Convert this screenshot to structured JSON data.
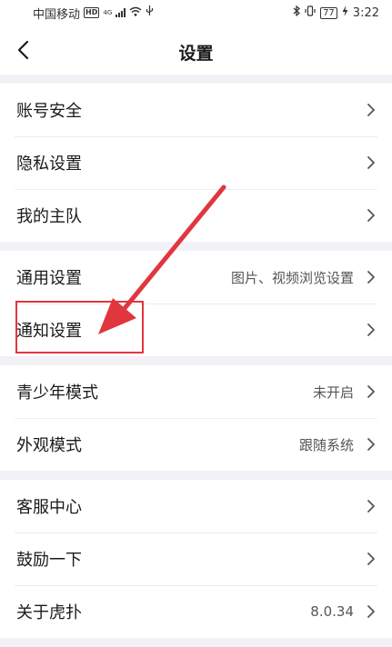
{
  "status_bar": {
    "carrier": "中国移动",
    "hd": "HD",
    "network": "4G",
    "battery": "77",
    "time": "3:22"
  },
  "header": {
    "title": "设置",
    "back_icon": "chevron-left-icon"
  },
  "groups": [
    {
      "items": [
        {
          "label": "账号安全"
        },
        {
          "label": "隐私设置"
        },
        {
          "label": "我的主队"
        }
      ]
    },
    {
      "items": [
        {
          "label": "通用设置",
          "value": "图片、视频浏览设置"
        },
        {
          "label": "通知设置"
        }
      ]
    },
    {
      "items": [
        {
          "label": "青少年模式",
          "value": "未开启"
        },
        {
          "label": "外观模式",
          "value": "跟随系统"
        }
      ]
    },
    {
      "items": [
        {
          "label": "客服中心"
        },
        {
          "label": "鼓励一下"
        },
        {
          "label": "关于虎扑",
          "value": "8.0.34"
        }
      ]
    }
  ],
  "colors": {
    "annotation": "#e0373f",
    "background": "#f2f1f6",
    "chevron": "#555555"
  }
}
